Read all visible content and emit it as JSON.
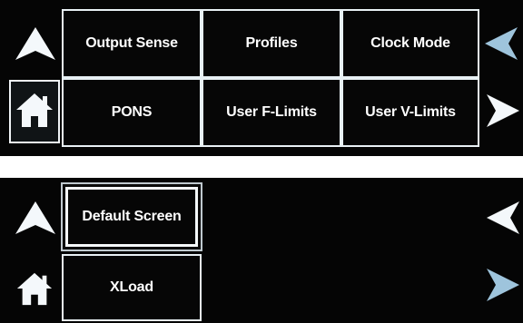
{
  "menu_page_1": {
    "buttons": [
      "Output Sense",
      "Profiles",
      "Clock Mode",
      "PONS",
      "User F-Limits",
      "User V-Limits"
    ],
    "up_icon": "up-arrow-icon",
    "home_icon": "home-icon",
    "prev_icon": "left-arrow-icon",
    "next_icon": "right-arrow-icon",
    "home_selected": true
  },
  "menu_page_2": {
    "buttons": [
      "Default Screen",
      "XLoad"
    ],
    "selected": "Default Screen",
    "up_icon": "up-arrow-icon",
    "home_icon": "home-icon",
    "prev_icon": "left-arrow-icon",
    "next_icon": "right-arrow-icon"
  },
  "colors": {
    "background": "#050505",
    "button_border": "#e8f0f4",
    "text": "#ffffff",
    "arrow_white": "#ffffff",
    "arrow_blue": "#9ec4dc"
  }
}
